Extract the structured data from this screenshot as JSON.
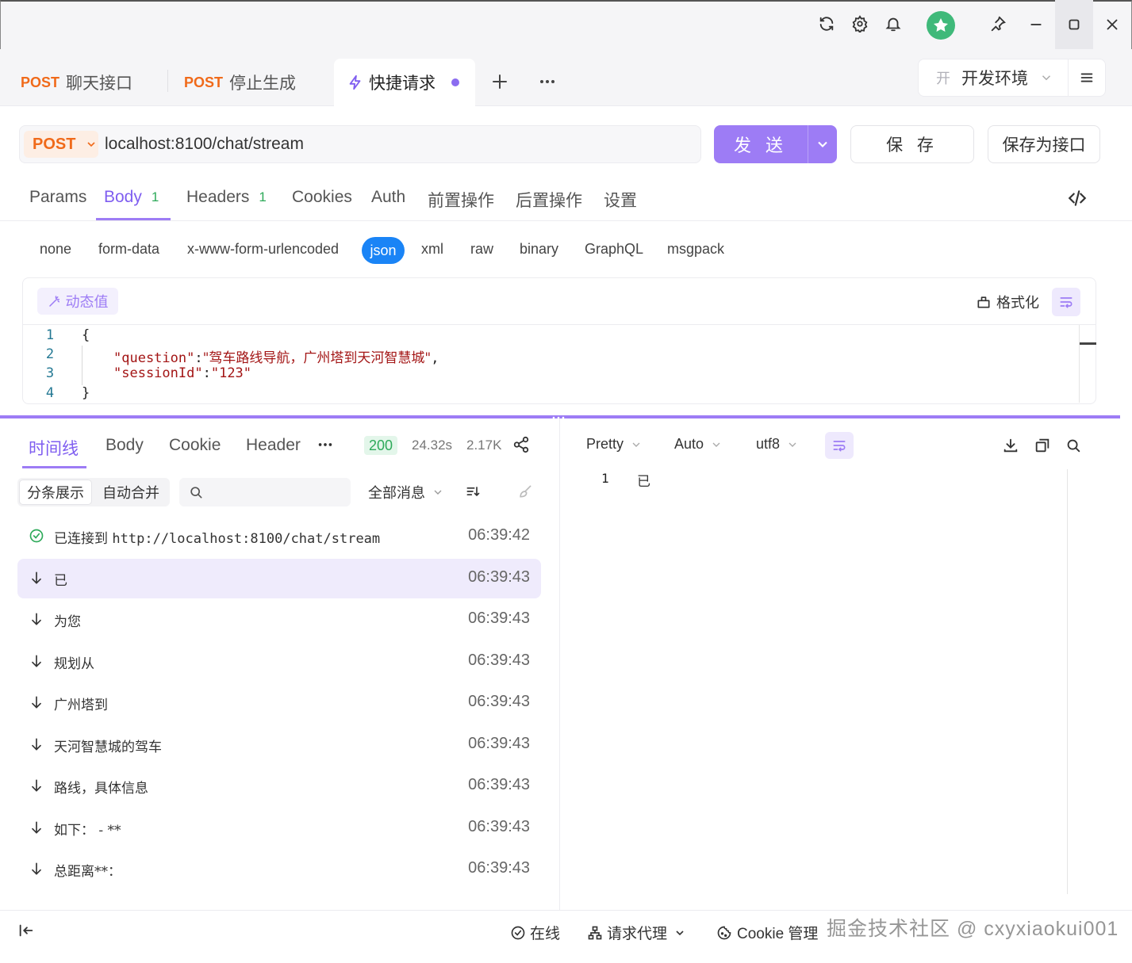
{
  "titlebar": {
    "icons": [
      "refresh-icon",
      "settings-icon",
      "bell-icon",
      "avatar",
      "pin-icon",
      "minimize-icon",
      "maximize-icon",
      "close-icon"
    ]
  },
  "tabs": [
    {
      "method": "POST",
      "label": "聊天接口"
    },
    {
      "method": "POST",
      "label": "停止生成"
    },
    {
      "label": "快捷请求",
      "icon": "lightning-icon",
      "active": true
    }
  ],
  "environment": {
    "badge": "开",
    "label": "开发环境"
  },
  "request": {
    "method": "POST",
    "url": "localhost:8100/chat/stream",
    "send_label": "发 送",
    "save_label": "保 存",
    "save_as_label": "保存为接口"
  },
  "request_tabs": [
    {
      "label": "Params"
    },
    {
      "label": "Body",
      "count": "1",
      "active": true
    },
    {
      "label": "Headers",
      "count": "1"
    },
    {
      "label": "Cookies"
    },
    {
      "label": "Auth"
    },
    {
      "label": "前置操作"
    },
    {
      "label": "后置操作"
    },
    {
      "label": "设置"
    }
  ],
  "body_types": [
    "none",
    "form-data",
    "x-www-form-urlencoded",
    "json",
    "xml",
    "raw",
    "binary",
    "GraphQL",
    "msgpack"
  ],
  "body_type_selected": "json",
  "editor": {
    "dynamic_label": "动态值",
    "format_label": "格式化",
    "lines": [
      {
        "num": "1",
        "text": "{"
      },
      {
        "num": "2",
        "key": "\"question\"",
        "sep": ":",
        "value": "\"驾车路线导航，广州塔到天河智慧城\"",
        "tail": ","
      },
      {
        "num": "3",
        "key": "\"sessionId\"",
        "sep": ":",
        "value": "\"123\"",
        "tail": ""
      },
      {
        "num": "4",
        "text": "}"
      }
    ]
  },
  "response": {
    "tabs": [
      "时间线",
      "Body",
      "Cookie",
      "Header"
    ],
    "status": "200",
    "time": "24.32s",
    "size": "2.17K",
    "view_modes": [
      "分条展示",
      "自动合并"
    ],
    "filter": "全部消息",
    "timeline": [
      {
        "icon": "check-circle-icon",
        "prefix": "已连接到 ",
        "text": "http://localhost:8100/chat/stream",
        "time": "06:39:42"
      },
      {
        "icon": "arrow-down-icon",
        "text": "已",
        "time": "06:39:43",
        "selected": true
      },
      {
        "icon": "arrow-down-icon",
        "text": "为您",
        "time": "06:39:43"
      },
      {
        "icon": "arrow-down-icon",
        "text": "规划从",
        "time": "06:39:43"
      },
      {
        "icon": "arrow-down-icon",
        "text": "广州塔到",
        "time": "06:39:43"
      },
      {
        "icon": "arrow-down-icon",
        "text": "天河智慧城的驾车",
        "time": "06:39:43"
      },
      {
        "icon": "arrow-down-icon",
        "text": "路线，具体信息",
        "time": "06:39:43"
      },
      {
        "icon": "arrow-down-icon",
        "text": "如下： - **",
        "time": "06:39:43"
      },
      {
        "icon": "arrow-down-icon",
        "text": "总距离**：",
        "time": "06:39:43"
      }
    ],
    "preview": {
      "format": "Pretty",
      "mode": "Auto",
      "encoding": "utf8",
      "line_num": "1",
      "line_text": "已"
    }
  },
  "footer": {
    "online": "在线",
    "proxy": "请求代理",
    "cookie": "Cookie 管理",
    "watermark": "掘金技术社区 @ cxyxiaokui001"
  },
  "colors": {
    "accent": "#9d7cf5",
    "method_post": "#f06a1a",
    "json_badge": "#1a84f6",
    "status_ok": "#2eaa5a"
  }
}
